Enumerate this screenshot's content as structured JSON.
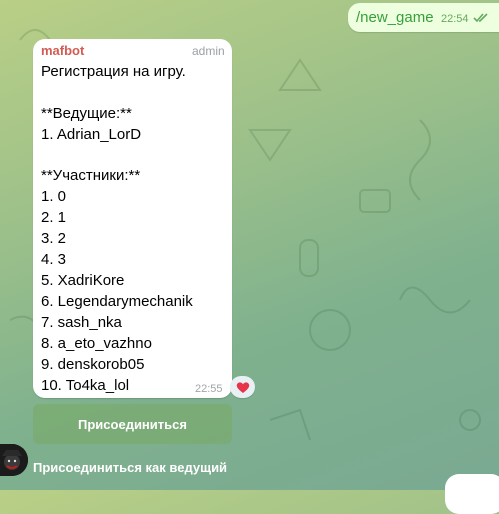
{
  "outgoing": {
    "text": "/new_game",
    "time": "22:54",
    "status_icon": "double-check-icon"
  },
  "incoming": {
    "sender": "mafbot",
    "role": "admin",
    "title": "Регистрация на игру.",
    "hosts_header": "**Ведущие:**",
    "hosts": [
      "1. Adrian_LorD"
    ],
    "participants_header": "**Участники:**",
    "participants": [
      "1. 0",
      "2. 1",
      "3. 2",
      "4. 3",
      "5. XadriKore",
      "6. Legendarymechanik",
      "7. sash_nka",
      "8. a_eto_vazhno",
      "9. denskorob05",
      "10. To4ka_lol"
    ],
    "time": "22:55",
    "reaction": "heart-emoji"
  },
  "keyboard": {
    "join_label": "Присоединиться",
    "join_host_label": "Присоединиться как ведущий"
  },
  "colors": {
    "outgoing_bubble": "#eeffdf",
    "outgoing_text": "#38a03a",
    "sender_name": "#d25c53",
    "heart": "#e8344a"
  }
}
